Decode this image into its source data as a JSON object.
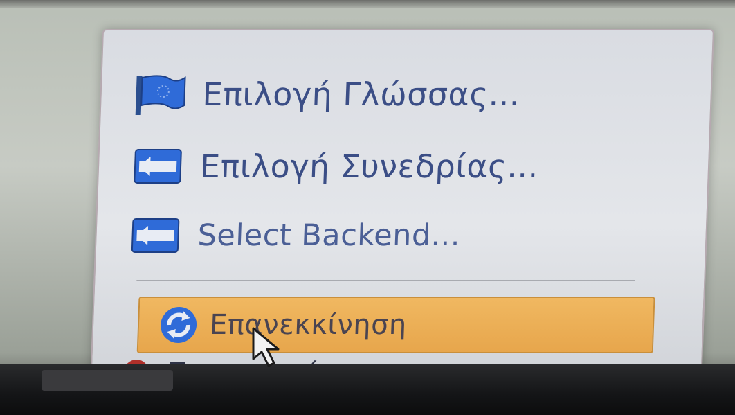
{
  "menu": {
    "items": [
      {
        "icon": "flag-icon",
        "label": "Επιλογή Γλώσσας..."
      },
      {
        "icon": "arrow-left-box-icon",
        "label": "Επιλογή Συνεδρίας..."
      },
      {
        "icon": "arrow-left-box-icon",
        "label": "Select Backend..."
      },
      {
        "icon": "refresh-icon",
        "label": "Επανεκκίνηση",
        "highlighted": true
      },
      {
        "icon": "power-icon",
        "label": "Τερματισμός"
      }
    ]
  },
  "colors": {
    "menu_text": "#3b4e86",
    "highlight": "#e7a64c",
    "icon_blue": "#2f6bd8"
  }
}
